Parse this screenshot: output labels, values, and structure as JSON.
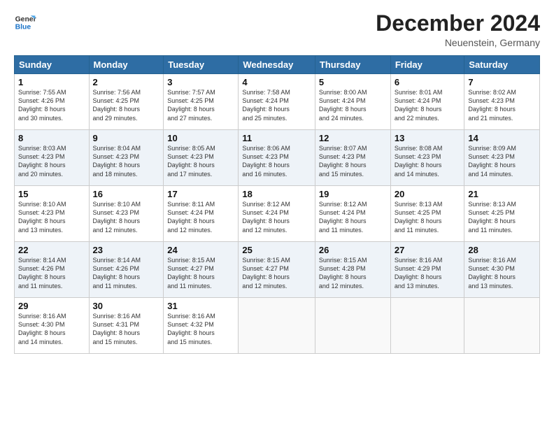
{
  "logo": {
    "line1": "General",
    "line2": "Blue"
  },
  "title": "December 2024",
  "subtitle": "Neuenstein, Germany",
  "days_header": [
    "Sunday",
    "Monday",
    "Tuesday",
    "Wednesday",
    "Thursday",
    "Friday",
    "Saturday"
  ],
  "weeks": [
    [
      {
        "num": "1",
        "detail": "Sunrise: 7:55 AM\nSunset: 4:26 PM\nDaylight: 8 hours\nand 30 minutes."
      },
      {
        "num": "2",
        "detail": "Sunrise: 7:56 AM\nSunset: 4:25 PM\nDaylight: 8 hours\nand 29 minutes."
      },
      {
        "num": "3",
        "detail": "Sunrise: 7:57 AM\nSunset: 4:25 PM\nDaylight: 8 hours\nand 27 minutes."
      },
      {
        "num": "4",
        "detail": "Sunrise: 7:58 AM\nSunset: 4:24 PM\nDaylight: 8 hours\nand 25 minutes."
      },
      {
        "num": "5",
        "detail": "Sunrise: 8:00 AM\nSunset: 4:24 PM\nDaylight: 8 hours\nand 24 minutes."
      },
      {
        "num": "6",
        "detail": "Sunrise: 8:01 AM\nSunset: 4:24 PM\nDaylight: 8 hours\nand 22 minutes."
      },
      {
        "num": "7",
        "detail": "Sunrise: 8:02 AM\nSunset: 4:23 PM\nDaylight: 8 hours\nand 21 minutes."
      }
    ],
    [
      {
        "num": "8",
        "detail": "Sunrise: 8:03 AM\nSunset: 4:23 PM\nDaylight: 8 hours\nand 20 minutes."
      },
      {
        "num": "9",
        "detail": "Sunrise: 8:04 AM\nSunset: 4:23 PM\nDaylight: 8 hours\nand 18 minutes."
      },
      {
        "num": "10",
        "detail": "Sunrise: 8:05 AM\nSunset: 4:23 PM\nDaylight: 8 hours\nand 17 minutes."
      },
      {
        "num": "11",
        "detail": "Sunrise: 8:06 AM\nSunset: 4:23 PM\nDaylight: 8 hours\nand 16 minutes."
      },
      {
        "num": "12",
        "detail": "Sunrise: 8:07 AM\nSunset: 4:23 PM\nDaylight: 8 hours\nand 15 minutes."
      },
      {
        "num": "13",
        "detail": "Sunrise: 8:08 AM\nSunset: 4:23 PM\nDaylight: 8 hours\nand 14 minutes."
      },
      {
        "num": "14",
        "detail": "Sunrise: 8:09 AM\nSunset: 4:23 PM\nDaylight: 8 hours\nand 14 minutes."
      }
    ],
    [
      {
        "num": "15",
        "detail": "Sunrise: 8:10 AM\nSunset: 4:23 PM\nDaylight: 8 hours\nand 13 minutes."
      },
      {
        "num": "16",
        "detail": "Sunrise: 8:10 AM\nSunset: 4:23 PM\nDaylight: 8 hours\nand 12 minutes."
      },
      {
        "num": "17",
        "detail": "Sunrise: 8:11 AM\nSunset: 4:24 PM\nDaylight: 8 hours\nand 12 minutes."
      },
      {
        "num": "18",
        "detail": "Sunrise: 8:12 AM\nSunset: 4:24 PM\nDaylight: 8 hours\nand 12 minutes."
      },
      {
        "num": "19",
        "detail": "Sunrise: 8:12 AM\nSunset: 4:24 PM\nDaylight: 8 hours\nand 11 minutes."
      },
      {
        "num": "20",
        "detail": "Sunrise: 8:13 AM\nSunset: 4:25 PM\nDaylight: 8 hours\nand 11 minutes."
      },
      {
        "num": "21",
        "detail": "Sunrise: 8:13 AM\nSunset: 4:25 PM\nDaylight: 8 hours\nand 11 minutes."
      }
    ],
    [
      {
        "num": "22",
        "detail": "Sunrise: 8:14 AM\nSunset: 4:26 PM\nDaylight: 8 hours\nand 11 minutes."
      },
      {
        "num": "23",
        "detail": "Sunrise: 8:14 AM\nSunset: 4:26 PM\nDaylight: 8 hours\nand 11 minutes."
      },
      {
        "num": "24",
        "detail": "Sunrise: 8:15 AM\nSunset: 4:27 PM\nDaylight: 8 hours\nand 11 minutes."
      },
      {
        "num": "25",
        "detail": "Sunrise: 8:15 AM\nSunset: 4:27 PM\nDaylight: 8 hours\nand 12 minutes."
      },
      {
        "num": "26",
        "detail": "Sunrise: 8:15 AM\nSunset: 4:28 PM\nDaylight: 8 hours\nand 12 minutes."
      },
      {
        "num": "27",
        "detail": "Sunrise: 8:16 AM\nSunset: 4:29 PM\nDaylight: 8 hours\nand 13 minutes."
      },
      {
        "num": "28",
        "detail": "Sunrise: 8:16 AM\nSunset: 4:30 PM\nDaylight: 8 hours\nand 13 minutes."
      }
    ],
    [
      {
        "num": "29",
        "detail": "Sunrise: 8:16 AM\nSunset: 4:30 PM\nDaylight: 8 hours\nand 14 minutes."
      },
      {
        "num": "30",
        "detail": "Sunrise: 8:16 AM\nSunset: 4:31 PM\nDaylight: 8 hours\nand 15 minutes."
      },
      {
        "num": "31",
        "detail": "Sunrise: 8:16 AM\nSunset: 4:32 PM\nDaylight: 8 hours\nand 15 minutes."
      },
      null,
      null,
      null,
      null
    ]
  ]
}
